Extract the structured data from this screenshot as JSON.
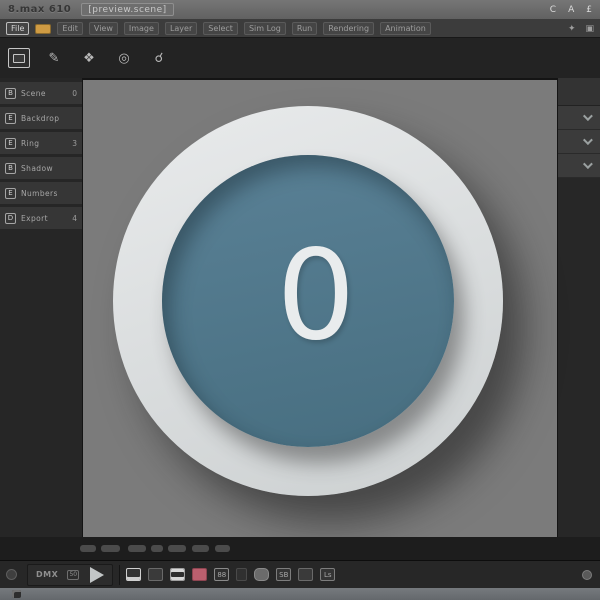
{
  "window": {
    "title": "8.max 610",
    "doc_label": "[preview.scene]",
    "controls": [
      "C",
      "A",
      "£"
    ]
  },
  "menubar": {
    "items": [
      "File",
      "Edit",
      "View",
      "Image",
      "Layer",
      "Select",
      "Sim Log",
      "Run",
      "Rendering",
      "Animation"
    ],
    "right_controls": [
      "✦",
      "▣"
    ],
    "accent_color": "#cf9b43"
  },
  "toolbar": {
    "tools": [
      {
        "name": "select-tool",
        "glyph": ""
      },
      {
        "name": "brush-tool",
        "glyph": "✎"
      },
      {
        "name": "gradient-tool",
        "glyph": "❖"
      },
      {
        "name": "ring-tool",
        "glyph": "◎"
      },
      {
        "name": "picker-tool",
        "glyph": "☌"
      }
    ]
  },
  "sidebar": {
    "items": [
      {
        "icon": "B",
        "label": "Scene",
        "badge": "0"
      },
      {
        "icon": "E",
        "label": "Backdrop",
        "badge": ""
      },
      {
        "icon": "E",
        "label": "Ring",
        "badge": "3"
      },
      {
        "icon": "B",
        "label": "Shadow",
        "badge": ""
      },
      {
        "icon": "E",
        "label": "Numbers",
        "badge": ""
      },
      {
        "icon": "D",
        "label": "Export",
        "badge": "4"
      }
    ]
  },
  "canvas": {
    "digit": "0",
    "bg_color": "#7b7b7b",
    "ring_color": "#e0e3e4",
    "inner_color": "#54798d"
  },
  "right_panel": {
    "sections": [
      {
        "name": "section-1"
      },
      {
        "name": "section-2"
      },
      {
        "name": "section-3"
      }
    ]
  },
  "timeline": {
    "segment_count": 7
  },
  "bottombar": {
    "mode_label": "DMX",
    "mini_icon": "50",
    "grid_icon_text": "88",
    "sb_icon_text": "SB",
    "layers_icon_text": "Ls",
    "swatch_color": "#bb5f6e"
  }
}
